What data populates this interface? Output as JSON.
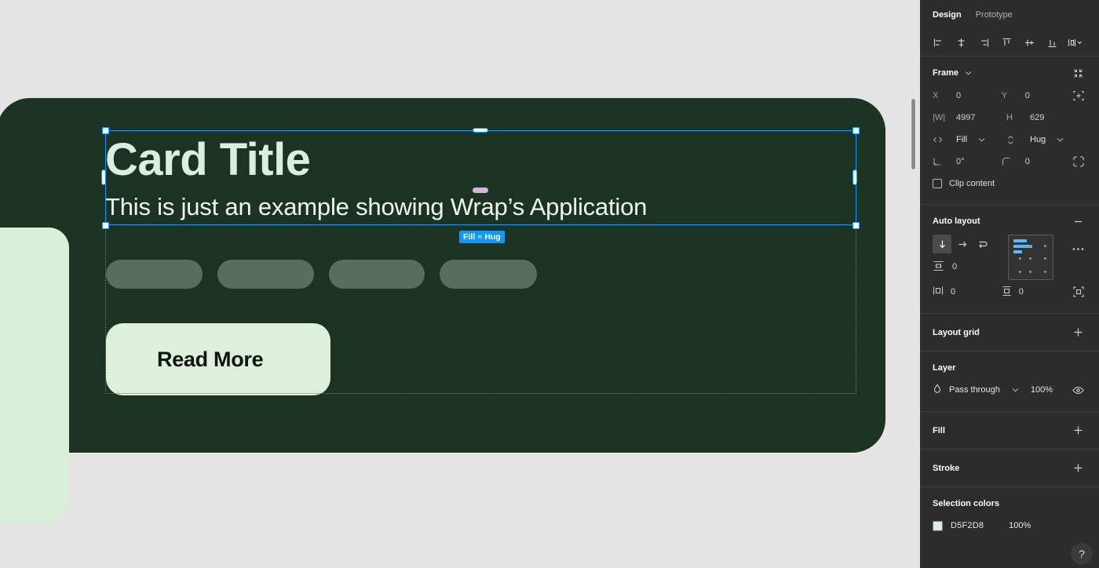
{
  "canvas": {
    "card": {
      "title": "Card Title",
      "subtitle": "This is just an example showing Wrap’s Application",
      "button_label": "Read More",
      "pills": [
        "",
        "",
        "",
        ""
      ],
      "bg_color": "#1C3322",
      "pill_color": "#566E5C",
      "accent_color": "#D5F2D8"
    },
    "selection": {
      "size_badge": "Fill × Hug",
      "badge_width": "Fill",
      "badge_sep": "×",
      "badge_height": "Hug",
      "selection_color": "#0D99FF",
      "spacing_handle_color": "#D7B4E0"
    }
  },
  "panel": {
    "tabs": [
      {
        "label": "Design",
        "active": true
      },
      {
        "label": "Prototype",
        "active": false
      }
    ],
    "align_tools": [
      {
        "name": "align-left-icon",
        "label": "Align left"
      },
      {
        "name": "align-horizontal-centers-icon",
        "label": "Align horizontal centers"
      },
      {
        "name": "align-right-icon",
        "label": "Align right"
      },
      {
        "name": "align-top-icon",
        "label": "Align top"
      },
      {
        "name": "align-vertical-centers-icon",
        "label": "Align vertical centers"
      },
      {
        "name": "align-bottom-icon",
        "label": "Align bottom"
      },
      {
        "name": "distribute-icon",
        "label": "Distribute"
      }
    ],
    "frame": {
      "title": "Frame",
      "x_label": "X",
      "x_value": "0",
      "y_label": "Y",
      "y_value": "0",
      "w_label": "|W|",
      "w_value": "4997",
      "h_label": "H",
      "h_value": "629",
      "resize_h_value": "Fill",
      "resize_v_value": "Hug",
      "rotation_value": "0°",
      "corner_radius_value": "0",
      "clip_content_label": "Clip content"
    },
    "auto_layout": {
      "title": "Auto layout",
      "directions": [
        {
          "name": "vertical-direction-icon",
          "selected": true
        },
        {
          "name": "horizontal-direction-icon",
          "selected": false
        },
        {
          "name": "wrap-direction-icon",
          "selected": false
        }
      ],
      "gap_value": "0",
      "horizontal_padding_value": "0",
      "vertical_padding_value": "0"
    },
    "layout_grid": {
      "title": "Layout grid"
    },
    "layer": {
      "title": "Layer",
      "blend_mode": "Pass through",
      "opacity": "100%"
    },
    "fill": {
      "title": "Fill"
    },
    "stroke": {
      "title": "Stroke"
    },
    "selection_colors": {
      "title": "Selection colors",
      "items": [
        {
          "hex": "D5F2D8",
          "opacity": "100%",
          "color": "#D5F2D8"
        }
      ]
    },
    "help": {
      "label": "?"
    }
  }
}
